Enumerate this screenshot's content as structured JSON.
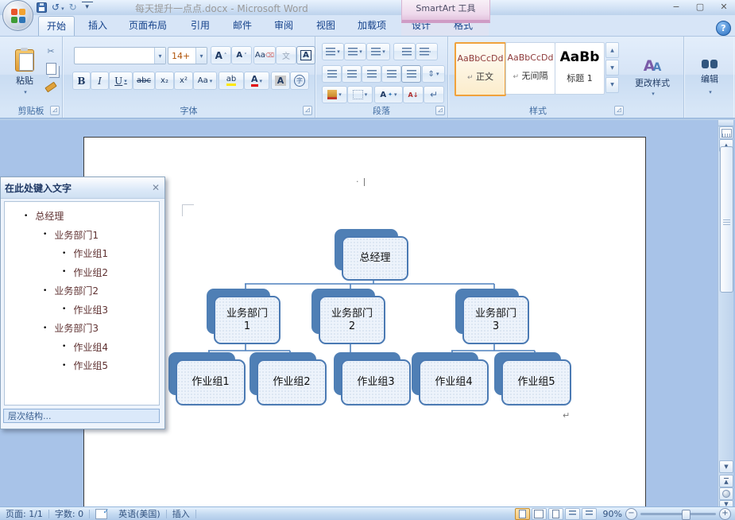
{
  "title_bar": {
    "title": "每天提升一点点.docx - Microsoft Word",
    "contextual_tab_group": "SmartArt 工具"
  },
  "icons": {
    "dropdown": "▾",
    "up": "▲",
    "down": "▼",
    "close": "✕",
    "minimize": "−",
    "maximize": "▢",
    "help": "?",
    "scissors": "✂",
    "undo": "↺",
    "redo": "↻",
    "launcher": "◿",
    "return_mark": "↵",
    "bullet": "•",
    "pilcrow": "¶",
    "sort": "A↓Z",
    "double_up": "≛",
    "more": "≡",
    "caret_dot": "·",
    "line_spacing": "⇕"
  },
  "tabs": [
    {
      "label": "开始",
      "active": true
    },
    {
      "label": "插入"
    },
    {
      "label": "页面布局"
    },
    {
      "label": "引用"
    },
    {
      "label": "邮件"
    },
    {
      "label": "审阅"
    },
    {
      "label": "视图"
    },
    {
      "label": "加载项"
    },
    {
      "label": "设计",
      "contextual": true
    },
    {
      "label": "格式",
      "contextual": true
    }
  ],
  "ribbon": {
    "clipboard": {
      "group_label": "剪贴板",
      "paste": "粘贴"
    },
    "font": {
      "group_label": "字体",
      "size_value": "14+",
      "buttons": {
        "bold": "B",
        "italic": "I",
        "underline": "U",
        "strike": "abc",
        "subscript": "x₂",
        "superscript": "x²",
        "change_case": "Aa",
        "clear": "Aa",
        "highlight": "ab",
        "font_color": "A",
        "char_shading": "A",
        "enclose": "字",
        "phonetic": "文",
        "grow": "A",
        "shrink": "A",
        "char_border": "A"
      }
    },
    "paragraph": {
      "group_label": "段落"
    },
    "styles": {
      "group_label": "样式",
      "change_styles": "更改样式",
      "items": [
        {
          "preview": "AaBbCcDd",
          "name": "正文",
          "selected": true
        },
        {
          "preview": "AaBbCcDd",
          "name": "无间隔"
        },
        {
          "preview": "AaBb",
          "name": "标题 1"
        }
      ]
    },
    "editing": {
      "button_label": "编辑"
    }
  },
  "text_pane": {
    "title": "在此处键入文字",
    "items": [
      {
        "label": "总经理",
        "level": 1
      },
      {
        "label": "业务部门1",
        "level": 2
      },
      {
        "label": "作业组1",
        "level": 3
      },
      {
        "label": "作业组2",
        "level": 3
      },
      {
        "label": "业务部门2",
        "level": 2
      },
      {
        "label": "作业组3",
        "level": 3
      },
      {
        "label": "业务部门3",
        "level": 2
      },
      {
        "label": "作业组4",
        "level": 3
      },
      {
        "label": "作业组5",
        "level": 3
      }
    ],
    "footer": "层次结构..."
  },
  "smartart": {
    "layout": "organization-chart",
    "accent_color": "#4f81bd",
    "nodes": [
      {
        "line1": "总经理",
        "line2": ""
      },
      {
        "line1": "业务部门",
        "line2": "1"
      },
      {
        "line1": "业务部门",
        "line2": "2"
      },
      {
        "line1": "业务部门",
        "line2": "3"
      },
      {
        "line1": "作业组1",
        "line2": ""
      },
      {
        "line1": "作业组2",
        "line2": ""
      },
      {
        "line1": "作业组3",
        "line2": ""
      },
      {
        "line1": "作业组4",
        "line2": ""
      },
      {
        "line1": "作业组5",
        "line2": ""
      }
    ],
    "hierarchy": {
      "总经理": {
        "业务部门1": [
          "作业组1",
          "作业组2"
        ],
        "业务部门2": [
          "作业组3"
        ],
        "业务部门3": [
          "作业组4",
          "作业组5"
        ]
      }
    }
  },
  "status_bar": {
    "page": "页面: 1/1",
    "word_count": "字数: 0",
    "language": "英语(美国)",
    "insert_mode": "插入",
    "zoom_level": "90%"
  }
}
